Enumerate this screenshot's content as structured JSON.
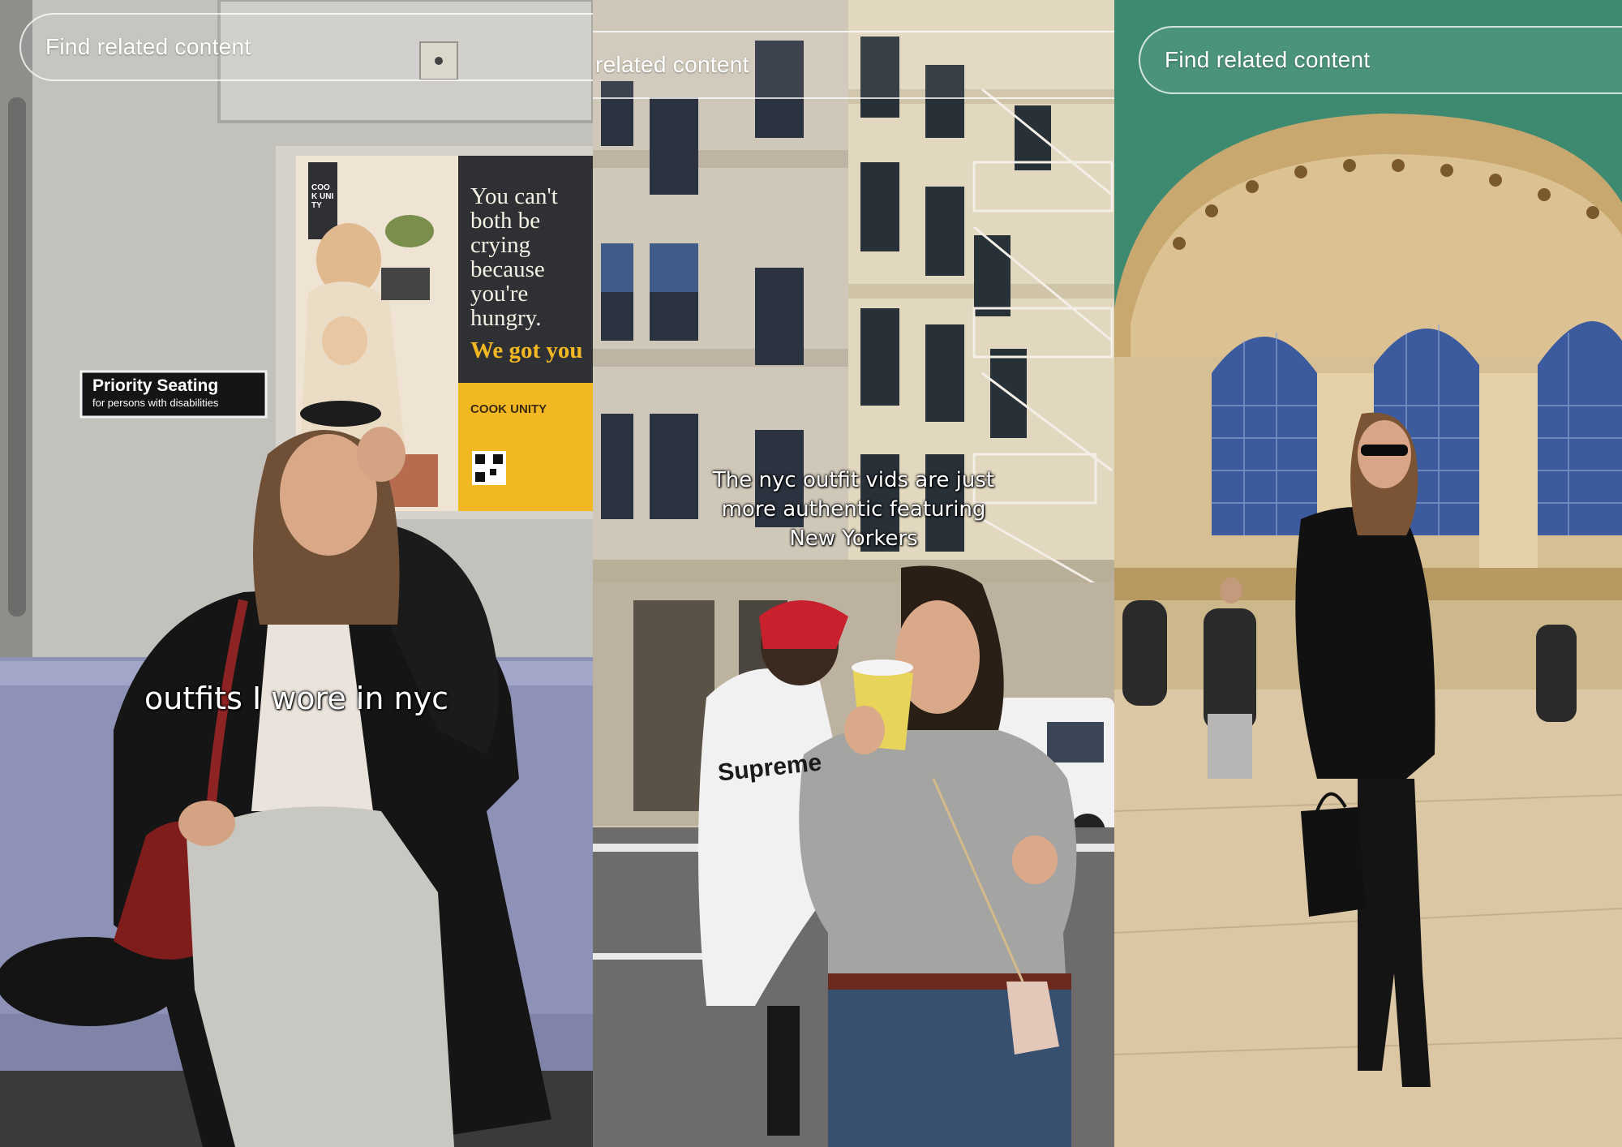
{
  "panels": [
    {
      "search_placeholder": "Find related content",
      "caption": "outfits I wore in nyc",
      "sign": {
        "title": "Priority Seating",
        "subtitle": "for persons with disabilities"
      },
      "ad": {
        "headline_lines": [
          "You can't",
          "both be",
          "crying",
          "because",
          "you're",
          "hungry."
        ],
        "accent_line": "We got you",
        "brand_vertical": "COOK UNITY",
        "brand_bottom": "COOK UNITY"
      }
    },
    {
      "search_placeholder": "related content",
      "caption_lines": [
        "The nyc outfit vids are just",
        "more authentic featuring",
        "New Yorkers"
      ],
      "hoodie_text": "Supreme"
    },
    {
      "search_placeholder": "Find related content"
    }
  ],
  "colors": {
    "subway_wall": "#b9b7b2",
    "seat": "#8e93b8",
    "ad_yellow": "#f2b824",
    "building_stone": "#cfc7b6",
    "cap_red": "#c8202c",
    "vault_green": "#3f8f74",
    "window_blue": "#3d5aa0"
  }
}
